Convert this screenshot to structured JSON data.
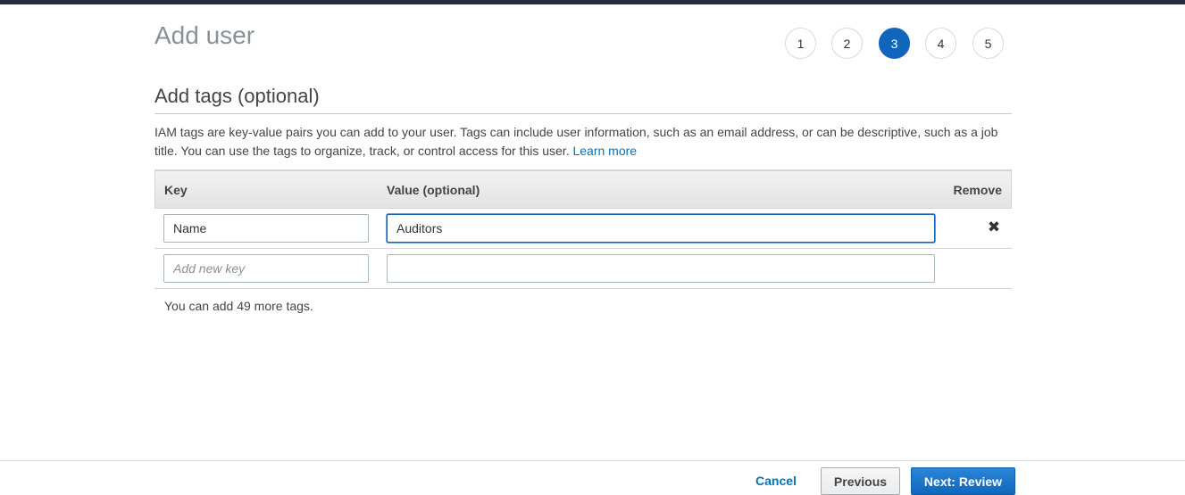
{
  "page": {
    "title": "Add user"
  },
  "steps": [
    {
      "label": "1",
      "active": false
    },
    {
      "label": "2",
      "active": false
    },
    {
      "label": "3",
      "active": true
    },
    {
      "label": "4",
      "active": false
    },
    {
      "label": "5",
      "active": false
    }
  ],
  "section": {
    "title": "Add tags (optional)",
    "description": "IAM tags are key-value pairs you can add to your user. Tags can include user information, such as an email address, or can be descriptive, such as a job title. You can use the tags to organize, track, or control access for this user.",
    "learn_more": "Learn more"
  },
  "table": {
    "headers": {
      "key": "Key",
      "value": "Value (optional)",
      "remove": "Remove"
    },
    "rows": [
      {
        "key": "Name",
        "value": "Auditors",
        "remove_icon": "close-icon"
      },
      {
        "key": "",
        "key_placeholder": "Add new key",
        "value": ""
      }
    ]
  },
  "remaining": "You can add 49 more tags.",
  "footer": {
    "cancel": "Cancel",
    "previous": "Previous",
    "next": "Next: Review"
  },
  "colors": {
    "accent": "#1166bb",
    "link": "#0073bb",
    "top_bar": "#232f3e"
  }
}
